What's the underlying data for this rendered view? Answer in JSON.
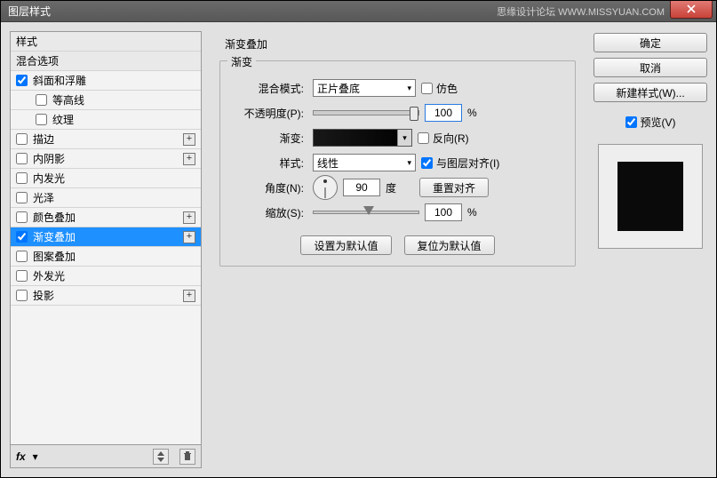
{
  "title": "图层样式",
  "watermark": "思缘设计论坛  WWW.MISSYUAN.COM",
  "styles": {
    "header1": "样式",
    "header2": "混合选项",
    "items": [
      {
        "label": "斜面和浮雕",
        "checked": true,
        "indent": false,
        "plus": false
      },
      {
        "label": "等高线",
        "checked": false,
        "indent": true,
        "plus": false
      },
      {
        "label": "纹理",
        "checked": false,
        "indent": true,
        "plus": false
      },
      {
        "label": "描边",
        "checked": false,
        "indent": false,
        "plus": true
      },
      {
        "label": "内阴影",
        "checked": false,
        "indent": false,
        "plus": true
      },
      {
        "label": "内发光",
        "checked": false,
        "indent": false,
        "plus": false
      },
      {
        "label": "光泽",
        "checked": false,
        "indent": false,
        "plus": false
      },
      {
        "label": "颜色叠加",
        "checked": false,
        "indent": false,
        "plus": true
      },
      {
        "label": "渐变叠加",
        "checked": true,
        "indent": false,
        "plus": true,
        "selected": true
      },
      {
        "label": "图案叠加",
        "checked": false,
        "indent": false,
        "plus": false
      },
      {
        "label": "外发光",
        "checked": false,
        "indent": false,
        "plus": false
      },
      {
        "label": "投影",
        "checked": false,
        "indent": false,
        "plus": true
      }
    ]
  },
  "footer_fx": "fx",
  "panel": {
    "outer_title": "渐变叠加",
    "inner_title": "渐变",
    "blend_label": "混合模式:",
    "blend_value": "正片叠底",
    "dither": "仿色",
    "opacity_label": "不透明度(P):",
    "opacity_value": "100",
    "pct": "%",
    "gradient_label": "渐变:",
    "reverse": "反向(R)",
    "style_label": "样式:",
    "style_value": "线性",
    "align_layer": "与图层对齐(I)",
    "angle_label": "角度(N):",
    "angle_value": "90",
    "degree": "度",
    "reset_align": "重置对齐",
    "scale_label": "缩放(S):",
    "scale_value": "100",
    "set_default": "设置为默认值",
    "reset_default": "复位为默认值"
  },
  "buttons": {
    "ok": "确定",
    "cancel": "取消",
    "new_style": "新建样式(W)...",
    "preview": "预览(V)"
  }
}
